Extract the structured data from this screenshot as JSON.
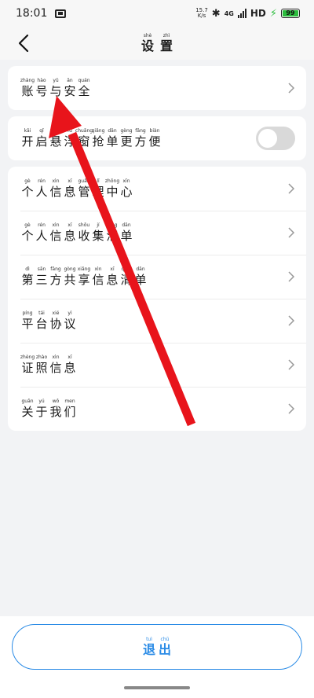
{
  "status_bar": {
    "time": "18:01",
    "net_speed_value": "15.7",
    "net_speed_unit": "K/s",
    "network": "4G",
    "hd": "HD",
    "battery_level": "99"
  },
  "header": {
    "title": [
      {
        "py": "shè",
        "hz": "设"
      },
      {
        "py": "zhì",
        "hz": "置"
      }
    ]
  },
  "card1": {
    "account_security": [
      {
        "py": "zhàng",
        "hz": "账"
      },
      {
        "py": "hào",
        "hz": "号"
      },
      {
        "py": "yǔ",
        "hz": "与"
      },
      {
        "py": "ān",
        "hz": "安"
      },
      {
        "py": "quán",
        "hz": "全"
      }
    ]
  },
  "card2": {
    "floating_window": [
      {
        "py": "kāi",
        "hz": "开"
      },
      {
        "py": "qǐ",
        "hz": "启"
      },
      {
        "py": "xuán",
        "hz": "悬"
      },
      {
        "py": "fú",
        "hz": "浮"
      },
      {
        "py": "chuāng",
        "hz": "窗"
      },
      {
        "py": "qiǎng",
        "hz": "抢"
      },
      {
        "py": "dān",
        "hz": "单"
      },
      {
        "py": "gèng",
        "hz": "更"
      },
      {
        "py": "fāng",
        "hz": "方"
      },
      {
        "py": "biàn",
        "hz": "便"
      }
    ],
    "toggle_on": false
  },
  "card3": {
    "items": [
      [
        {
          "py": "gè",
          "hz": "个"
        },
        {
          "py": "rén",
          "hz": "人"
        },
        {
          "py": "xìn",
          "hz": "信"
        },
        {
          "py": "xī",
          "hz": "息"
        },
        {
          "py": "guǎn",
          "hz": "管"
        },
        {
          "py": "lǐ",
          "hz": "理"
        },
        {
          "py": "zhōng",
          "hz": "中"
        },
        {
          "py": "xīn",
          "hz": "心"
        }
      ],
      [
        {
          "py": "gè",
          "hz": "个"
        },
        {
          "py": "rén",
          "hz": "人"
        },
        {
          "py": "xìn",
          "hz": "信"
        },
        {
          "py": "xī",
          "hz": "息"
        },
        {
          "py": "shōu",
          "hz": "收"
        },
        {
          "py": "jí",
          "hz": "集"
        },
        {
          "py": "qīng",
          "hz": "清"
        },
        {
          "py": "dān",
          "hz": "单"
        }
      ],
      [
        {
          "py": "dì",
          "hz": "第"
        },
        {
          "py": "sān",
          "hz": "三"
        },
        {
          "py": "fāng",
          "hz": "方"
        },
        {
          "py": "gòng",
          "hz": "共"
        },
        {
          "py": "xiǎng",
          "hz": "享"
        },
        {
          "py": "xìn",
          "hz": "信"
        },
        {
          "py": "xī",
          "hz": "息"
        },
        {
          "py": "qīng",
          "hz": "清"
        },
        {
          "py": "dān",
          "hz": "单"
        }
      ],
      [
        {
          "py": "píng",
          "hz": "平"
        },
        {
          "py": "tái",
          "hz": "台"
        },
        {
          "py": "xié",
          "hz": "协"
        },
        {
          "py": "yì",
          "hz": "议"
        }
      ],
      [
        {
          "py": "zhèng",
          "hz": "证"
        },
        {
          "py": "zhào",
          "hz": "照"
        },
        {
          "py": "xìn",
          "hz": "信"
        },
        {
          "py": "xī",
          "hz": "息"
        }
      ],
      [
        {
          "py": "guān",
          "hz": "关"
        },
        {
          "py": "yú",
          "hz": "于"
        },
        {
          "py": "wǒ",
          "hz": "我"
        },
        {
          "py": "men",
          "hz": "们"
        }
      ]
    ]
  },
  "logout": [
    {
      "py": "tuì",
      "hz": "退"
    },
    {
      "py": "chū",
      "hz": "出"
    }
  ],
  "colors": {
    "accent": "#2a8be6",
    "annotation_arrow": "#e8141b",
    "toggle_off": "#d9d9d9",
    "battery": "#2bbd3d"
  }
}
